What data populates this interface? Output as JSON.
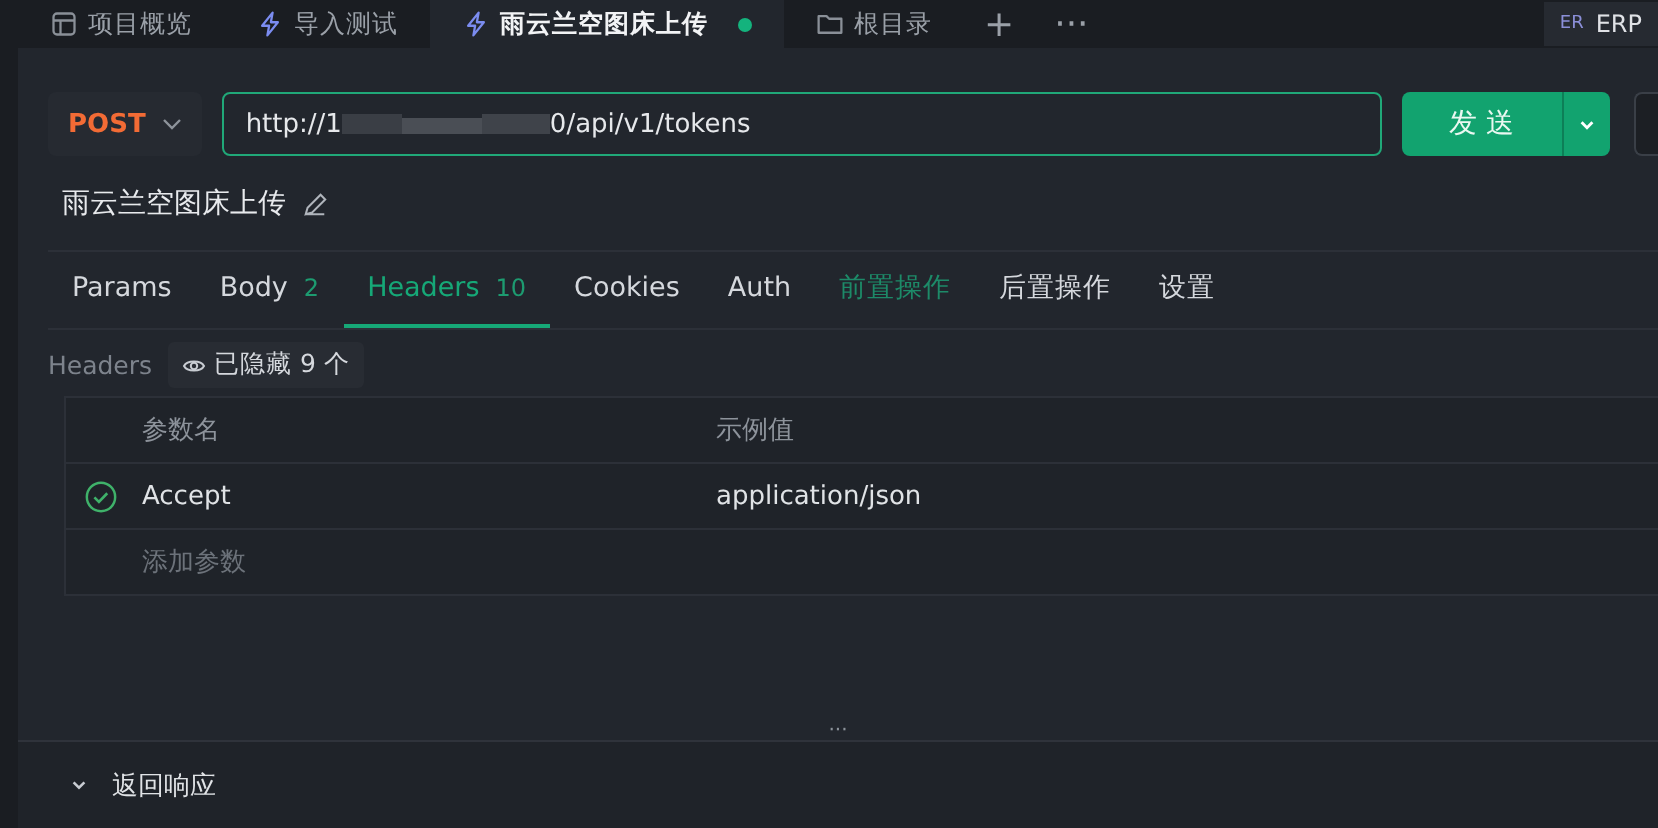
{
  "tabs": [
    {
      "label": "项目概览",
      "kind": "grid",
      "selected": false,
      "unsaved": false
    },
    {
      "label": "导入测试",
      "kind": "bolt",
      "selected": false,
      "unsaved": false
    },
    {
      "label": "雨云兰空图床上传",
      "kind": "bolt",
      "selected": true,
      "unsaved": true
    },
    {
      "label": "根目录",
      "kind": "folder",
      "selected": false,
      "unsaved": false
    }
  ],
  "new_tab": "+",
  "more": "···",
  "workspace": {
    "badge": "ER",
    "name": "ERP"
  },
  "request": {
    "method": "POST",
    "url_start": "http://1",
    "url_redacted": true,
    "url_end": "0/api/v1/tokens",
    "send": "发 送"
  },
  "name": "雨云兰空图床上传",
  "subtabs": [
    {
      "label": "Params",
      "selected": false,
      "highlighted": false
    },
    {
      "label": "Body",
      "count": "2",
      "selected": false,
      "highlighted": false
    },
    {
      "label": "Headers",
      "count": "10",
      "selected": true,
      "highlighted": false
    },
    {
      "label": "Cookies",
      "selected": false,
      "highlighted": false
    },
    {
      "label": "Auth",
      "selected": false,
      "highlighted": false
    },
    {
      "label": "前置操作",
      "selected": false,
      "highlighted": true
    },
    {
      "label": "后置操作",
      "selected": false,
      "highlighted": false
    },
    {
      "label": "设置",
      "selected": false,
      "highlighted": false
    }
  ],
  "headers_label": "Headers",
  "hidden_toggle": "已隐藏 9 个",
  "table": {
    "columns": [
      "参数名",
      "示例值"
    ],
    "rows": [
      {
        "enabled": true,
        "name": "Accept",
        "value": "application/json"
      }
    ],
    "add_placeholder": "添加参数"
  },
  "resize_handle": "···",
  "response": {
    "label": "返回响应",
    "expanded": false
  }
}
